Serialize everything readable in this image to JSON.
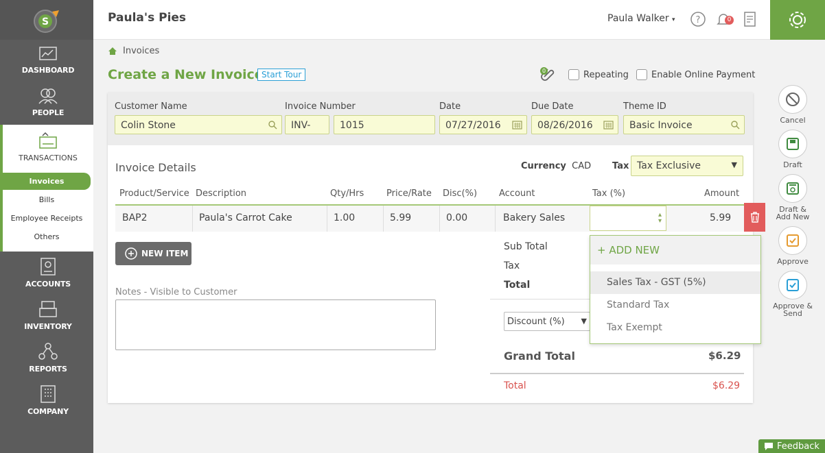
{
  "company": "Paula's Pies",
  "user_name": "Paula Walker",
  "notification_count": "0",
  "sidebar": {
    "dashboard": "DASHBOARD",
    "people": "PEOPLE",
    "transactions": "TRANSACTIONS",
    "sub_items": [
      "Invoices",
      "Bills",
      "Employee Receipts",
      "Others"
    ],
    "accounts": "ACCOUNTS",
    "inventory": "INVENTORY",
    "reports": "REPORTS",
    "company": "COMPANY"
  },
  "breadcrumb": "Invoices",
  "page_title": "Create a New Invoice",
  "start_tour": "Start Tour",
  "attachment_count": "0",
  "repeating_label": "Repeating",
  "online_payment_label": "Enable Online Payment",
  "fields": {
    "customer_name_label": "Customer Name",
    "customer_name": "Colin Stone",
    "invoice_number_label": "Invoice Number",
    "invoice_prefix": "INV-",
    "invoice_number": "1015",
    "date_label": "Date",
    "date": "07/27/2016",
    "due_date_label": "Due Date",
    "due_date": "08/26/2016",
    "theme_label": "Theme ID",
    "theme": "Basic Invoice"
  },
  "details": {
    "title": "Invoice Details",
    "currency_label": "Currency",
    "currency": "CAD",
    "tax_label": "Tax",
    "tax_mode": "Tax Exclusive"
  },
  "table": {
    "headers": [
      "Product/Service",
      "Description",
      "Qty/Hrs",
      "Price/Rate",
      "Disc(%)",
      "Account",
      "Tax (%)",
      "Amount"
    ],
    "row": {
      "product": "BAP2",
      "description": "Paula's Carrot Cake",
      "qty": "1.00",
      "price": "5.99",
      "disc": "0.00",
      "account": "Bakery Sales",
      "tax": "",
      "amount": "5.99"
    }
  },
  "new_item": "NEW ITEM",
  "notes_label": "Notes - Visible to Customer",
  "summary": {
    "subtotal_label": "Sub Total",
    "tax_label": "Tax",
    "total_label": "Total",
    "discount_select": "Discount (%)",
    "grand_total_label": "Grand Total",
    "grand_total": "$6.29",
    "final_total_label": "Total",
    "final_total": "$6.29"
  },
  "tax_dropdown": {
    "add_new": "+ ADD NEW",
    "options": [
      "Sales Tax - GST (5%)",
      "Standard Tax",
      "Tax Exempt"
    ]
  },
  "actions": {
    "cancel": "Cancel",
    "draft": "Draft",
    "draft_add_new": "Draft & Add New",
    "approve": "Approve",
    "approve_send": "Approve & Send"
  },
  "feedback": "Feedback",
  "colors": {
    "accent": "#6fa545",
    "sidebar": "#5c5c5c",
    "input_bg": "#f9fbd6",
    "danger": "#e25c5c"
  }
}
